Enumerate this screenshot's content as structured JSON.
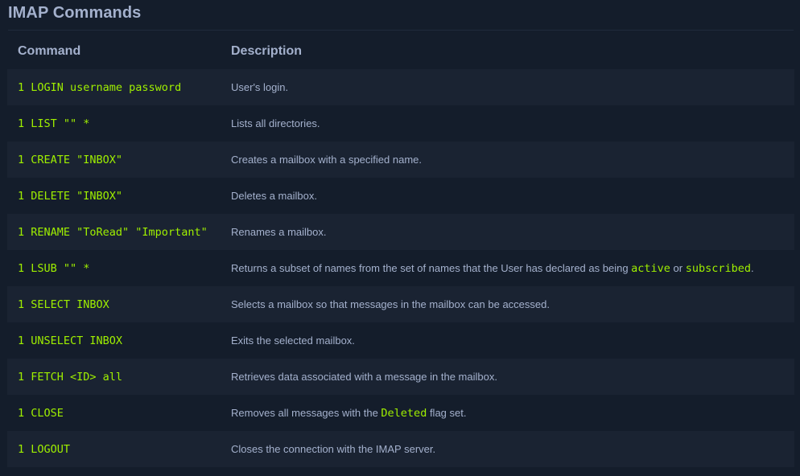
{
  "page_title": "IMAP Commands",
  "table": {
    "headers": [
      "Command",
      "Description"
    ],
    "rows": [
      {
        "command": "1 LOGIN username password",
        "desc_parts": [
          "User's login."
        ],
        "code_parts": []
      },
      {
        "command": "1 LIST \"\" *",
        "desc_parts": [
          "Lists all directories."
        ],
        "code_parts": []
      },
      {
        "command": "1 CREATE \"INBOX\"",
        "desc_parts": [
          "Creates a mailbox with a specified name."
        ],
        "code_parts": []
      },
      {
        "command": "1 DELETE \"INBOX\"",
        "desc_parts": [
          "Deletes a mailbox."
        ],
        "code_parts": []
      },
      {
        "command": "1 RENAME \"ToRead\" \"Important\"",
        "desc_parts": [
          "Renames a mailbox."
        ],
        "code_parts": []
      },
      {
        "command": "1 LSUB \"\" *",
        "desc_parts": [
          "Returns a subset of names from the set of names that the User has declared as being ",
          " or ",
          "."
        ],
        "code_parts": [
          "active",
          "subscribed"
        ]
      },
      {
        "command": "1 SELECT INBOX",
        "desc_parts": [
          "Selects a mailbox so that messages in the mailbox can be accessed."
        ],
        "code_parts": []
      },
      {
        "command": "1 UNSELECT INBOX",
        "desc_parts": [
          "Exits the selected mailbox."
        ],
        "code_parts": []
      },
      {
        "command": "1 FETCH <ID> all",
        "desc_parts": [
          "Retrieves data associated with a message in the mailbox."
        ],
        "code_parts": []
      },
      {
        "command": "1 CLOSE",
        "desc_parts": [
          "Removes all messages with the ",
          " flag set."
        ],
        "code_parts": [
          "Deleted"
        ]
      },
      {
        "command": "1 LOGOUT",
        "desc_parts": [
          "Closes the connection with the IMAP server."
        ],
        "code_parts": []
      }
    ]
  },
  "colors": {
    "background": "#141d2b",
    "row_alt": "#1a2332",
    "text": "#a4b1cd",
    "code": "#9fef00"
  }
}
